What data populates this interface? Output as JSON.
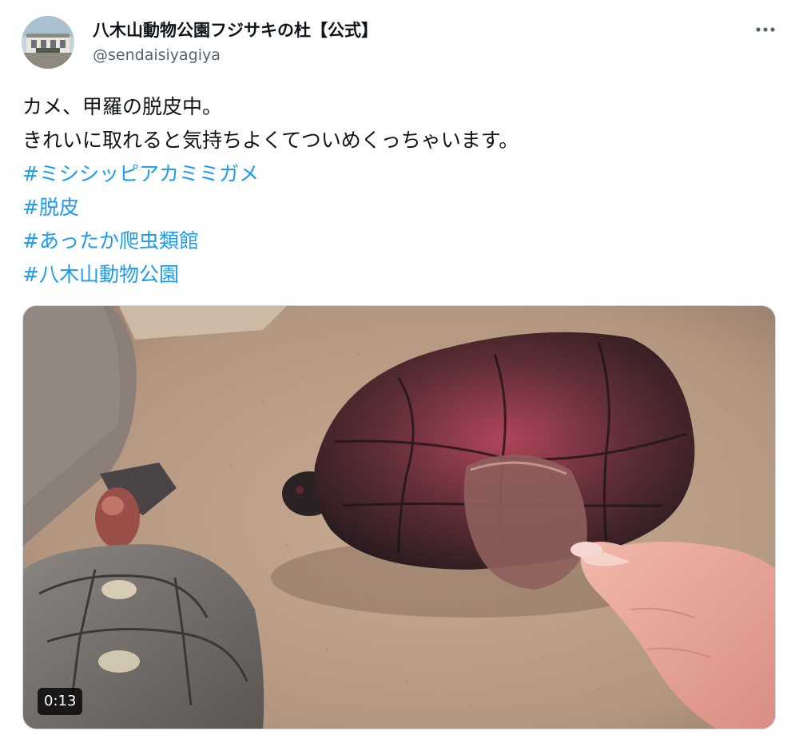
{
  "tweet": {
    "author": {
      "display_name": "八木山動物公園フジサキの杜【公式】",
      "handle": "@sendaisiyagiya"
    },
    "more_icon": "more-horizontal-icon",
    "text_lines": [
      "カメ、甲羅の脱皮中。",
      "きれいに取れると気持ちよくてついめくっちゃいます。"
    ],
    "hashtags": [
      "#ミシシッピアカミミガメ",
      "#脱皮",
      "#あったか爬虫類館",
      "#八木山動物公園"
    ],
    "media": {
      "type": "video",
      "duration": "0:13"
    },
    "colors": {
      "link": "#1d9bf0",
      "text": "#0f1419",
      "secondary": "#536471"
    }
  }
}
